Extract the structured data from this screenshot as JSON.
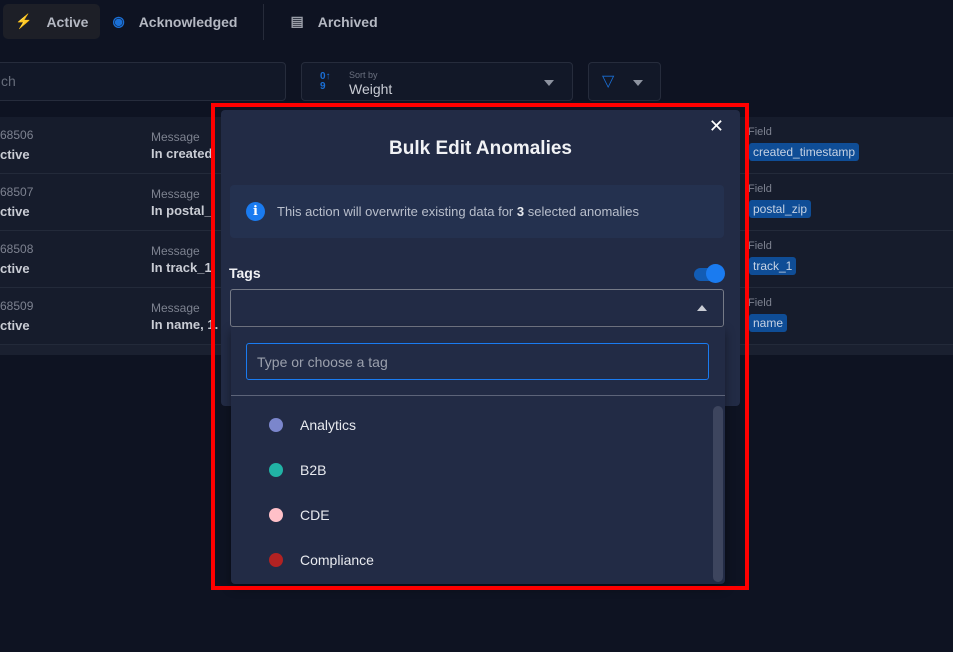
{
  "tabs": [
    {
      "label": "Active",
      "icon": "lightning-icon",
      "active": true
    },
    {
      "label": "Acknowledged",
      "icon": "eye-icon"
    },
    {
      "label": "Archived",
      "icon": "archive-icon"
    }
  ],
  "search": {
    "placeholder": "ch"
  },
  "sort": {
    "label": "Sort by",
    "value": "Weight"
  },
  "rows": [
    {
      "id": "68506",
      "status": "ctive",
      "message_label": "Message",
      "message": "In created",
      "field_label": "Field",
      "field": "created_timestamp"
    },
    {
      "id": "68507",
      "status": "ctive",
      "message_label": "Message",
      "message": "In postal_",
      "field_label": "Field",
      "field": "postal_zip"
    },
    {
      "id": "68508",
      "status": "ctive",
      "message_label": "Message",
      "message": "In track_1,",
      "field_label": "Field",
      "field": "track_1"
    },
    {
      "id": "68509",
      "status": "ctive",
      "message_label": "Message",
      "message": "In name, 1.",
      "field_label": "Field",
      "field": "name"
    }
  ],
  "modal": {
    "title": "Bulk Edit Anomalies",
    "info_pre": "This action will overwrite existing data for ",
    "info_count": "3",
    "info_post": " selected anomalies",
    "tags_label": "Tags",
    "tags_toggle_on": true,
    "tag_input_placeholder": "Type or choose a tag",
    "options": [
      {
        "label": "Analytics",
        "color": "#7b86cc"
      },
      {
        "label": "B2B",
        "color": "#21b3a5"
      },
      {
        "label": "CDE",
        "color": "#ffc0c8"
      },
      {
        "label": "Compliance",
        "color": "#b22222"
      }
    ]
  },
  "colors": {
    "accent": "#1a7bf0",
    "highlight": "#ff0000"
  }
}
